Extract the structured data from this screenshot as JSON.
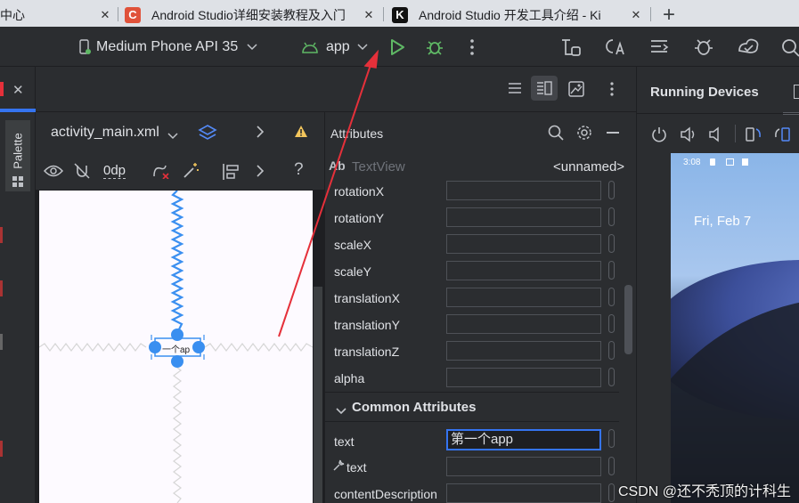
{
  "browser": {
    "tabs": [
      {
        "title": "中心",
        "active": false
      },
      {
        "title": "Android Studio详细安装教程及入门",
        "active": false,
        "favicon": "C"
      },
      {
        "title": "Android Studio 开发工具介绍 - Ki",
        "active": true,
        "favicon": "K"
      }
    ],
    "new_tab": "+"
  },
  "toolbar": {
    "device": "Medium Phone API 35",
    "run_config": "app"
  },
  "design": {
    "file_name": "activity_main.xml",
    "margin_value": "0dp",
    "palette_label": "Palette",
    "textview_preview": "一个ap"
  },
  "attributes": {
    "title": "Attributes",
    "component_type": "TextView",
    "component_prefix": "Ab",
    "component_id": "<unnamed>",
    "transform_rows": [
      "rotationX",
      "rotationY",
      "scaleX",
      "scaleY",
      "translationX",
      "translationY",
      "translationZ",
      "alpha"
    ],
    "section_title": "Common Attributes",
    "text_label": "text",
    "text_value": "第一个app",
    "tools_text_label": "text",
    "content_desc_label": "contentDescription"
  },
  "running_devices": {
    "title": "Running Devices",
    "status_time": "3:08",
    "lock_date": "Fri, Feb 7"
  },
  "watermark": "CSDN @还不秃顶的计科生",
  "colors": {
    "accent": "#3574f0",
    "run_green": "#5fb865",
    "warning": "#f2c55c",
    "arrow_red": "#e5303a"
  }
}
